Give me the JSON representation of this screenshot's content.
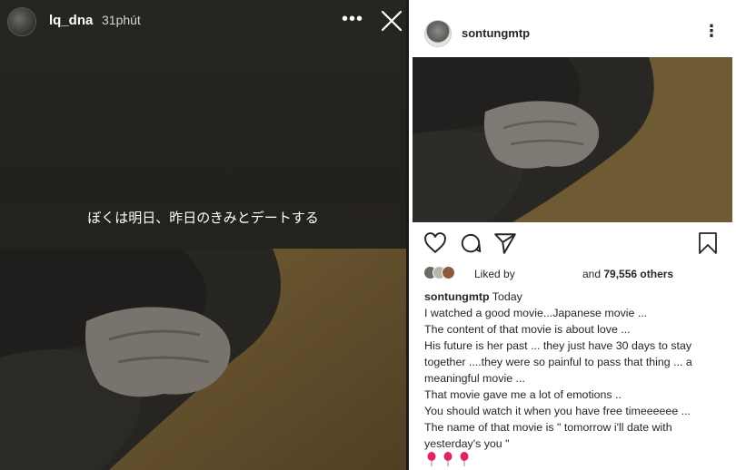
{
  "story": {
    "username": "lq_dna",
    "time_ago": "31phút",
    "more_icon": "more-horizontal-icon",
    "close_icon": "close-icon",
    "caption": "ぼくは明日、昨日のきみとデートする"
  },
  "post": {
    "username": "sontungmtp",
    "more_icon": "more-vertical-icon",
    "actions": [
      "heart-icon",
      "comment-icon",
      "share-icon",
      "bookmark-icon"
    ],
    "likes": {
      "liked_by": "Liked by",
      "and_text": "and",
      "count": "79,556 others"
    },
    "caption": {
      "username": "sontungmtp",
      "time": "Today",
      "lines": [
        "I watched a good movie...Japanese movie ...",
        "The content of that movie is about love ...",
        "His future is her past ... they just have 30 days to stay",
        "together ....they were so painful to pass that thing ... a",
        "meaningful movie ...",
        "That movie gave me a lot of emotions ..",
        "You should watch it when you have free timeeeeee ...",
        "The name of that movie is \" tomorrow i'll date with",
        "yesterday's you \""
      ],
      "emoji": "🎈🎈🎈"
    }
  },
  "colors": {
    "story_bg": "#23211d",
    "post_bg": "#ffffff",
    "text": "#262626",
    "scarf": "#8a6f3d"
  }
}
